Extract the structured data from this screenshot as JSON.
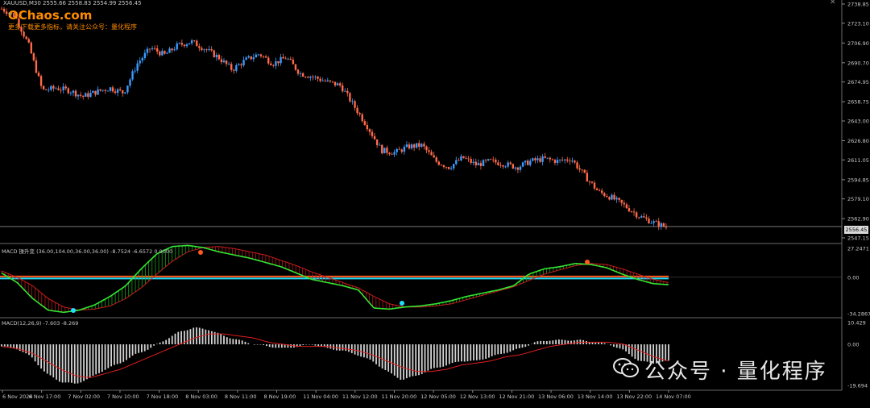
{
  "symbol_line": "XAUUSD,M30  2555.66 2558.83 2554.99 2556.45",
  "logo": "OChaos.com",
  "hint": "更多下载更多指标，请关注公众号：量化程序",
  "watermark": "公众号 · 量化程序",
  "current_price": "2556.45",
  "price_axis": [
    "2738.85",
    "2723.10",
    "2706.90",
    "2690.70",
    "2674.95",
    "2658.75",
    "2643.00",
    "2626.80",
    "2611.05",
    "2594.85",
    "2579.10",
    "2562.90",
    "2547.15"
  ],
  "macd1": {
    "label": "MACD 操升变 (36.00,104.00,36.00,36.00) -8.7524 -6.6572 0.0000",
    "axis": [
      "27.2471",
      "0.00",
      "-34.2867"
    ]
  },
  "macd2": {
    "label": "MACD(12,26,9) -7.603 -8.269",
    "axis": [
      "10.429",
      "0.00",
      "-19.694"
    ]
  },
  "time_axis": [
    "6 Nov 2024",
    "6 Nov 17:00",
    "7 Nov 02:00",
    "7 Nov 10:00",
    "7 Nov 18:00",
    "8 Nov 03:00",
    "8 Nov 11:00",
    "8 Nov 19:00",
    "11 Nov 04:00",
    "11 Nov 12:00",
    "11 Nov 20:00",
    "12 Nov 05:00",
    "12 Nov 13:00",
    "12 Nov 21:00",
    "13 Nov 06:00",
    "13 Nov 14:00",
    "13 Nov 22:00",
    "14 Nov 07:00"
  ],
  "colors": {
    "bull": "#3a9bff",
    "bear": "#ff6a4a",
    "fast_line": "#33e633",
    "slow_line": "#c81e1e",
    "macd_hist": "#d4d4d4",
    "signal_line": "#e01e1e",
    "zero_line": "#ff5a1e",
    "cyan_line": "#20e0ff"
  },
  "chart_data": {
    "type": "candlestick",
    "y_range": [
      2547.15,
      2738.85
    ],
    "close_path": [
      2735,
      2729,
      2705,
      2668,
      2670,
      2668,
      2663,
      2667,
      2670,
      2666,
      2690,
      2703,
      2697,
      2705,
      2708,
      2702,
      2695,
      2685,
      2693,
      2698,
      2690,
      2695,
      2682,
      2679,
      2675,
      2672,
      2655,
      2638,
      2619,
      2617,
      2622,
      2623,
      2610,
      2605,
      2613,
      2607,
      2610,
      2608,
      2605,
      2610,
      2612,
      2610,
      2612,
      2598,
      2585,
      2580,
      2573,
      2565,
      2560,
      2556
    ],
    "macd1_fast": [
      4,
      -5,
      -20,
      -31,
      -33,
      -31,
      -26,
      -18,
      -8,
      8,
      22,
      29,
      30,
      28,
      24,
      21,
      18,
      14,
      10,
      4,
      -2,
      -5,
      -8,
      -12,
      -29,
      -30,
      -28,
      -27,
      -25,
      -22,
      -18,
      -15,
      -12,
      -8,
      3,
      8,
      10,
      13,
      12,
      9,
      3,
      -2,
      -6,
      -7
    ],
    "macd1_slow": [
      6,
      0,
      -8,
      -20,
      -28,
      -31,
      -30,
      -27,
      -20,
      -10,
      3,
      15,
      24,
      28,
      29,
      27,
      24,
      21,
      16,
      11,
      5,
      0,
      -5,
      -10,
      -18,
      -25,
      -28,
      -28,
      -27,
      -25,
      -21,
      -17,
      -13,
      -9,
      -3,
      3,
      7,
      11,
      13,
      12,
      8,
      3,
      -2,
      -5
    ],
    "macd2_hist": [
      -1,
      -2,
      -6,
      -14,
      -18,
      -19,
      -16,
      -12,
      -9,
      -5,
      -2,
      2,
      6,
      8,
      7,
      4,
      2,
      0,
      -1,
      -2,
      -1,
      0,
      -2,
      -3,
      -5,
      -8,
      -13,
      -17,
      -15,
      -12,
      -10,
      -8,
      -8,
      -6,
      -4,
      -2,
      1,
      2,
      2,
      2,
      1,
      0,
      -3,
      -8,
      -9,
      -8
    ],
    "macd2_signal": [
      -1,
      -2,
      -4,
      -8,
      -12,
      -15,
      -16,
      -14,
      -12,
      -9,
      -6,
      -3,
      0,
      3,
      5,
      5,
      4,
      3,
      1,
      0,
      -1,
      -1,
      -1,
      -2,
      -3,
      -5,
      -8,
      -11,
      -13,
      -13,
      -12,
      -10,
      -9,
      -8,
      -6,
      -5,
      -3,
      -1,
      0,
      1,
      1,
      1,
      0,
      -3,
      -6,
      -8
    ]
  }
}
